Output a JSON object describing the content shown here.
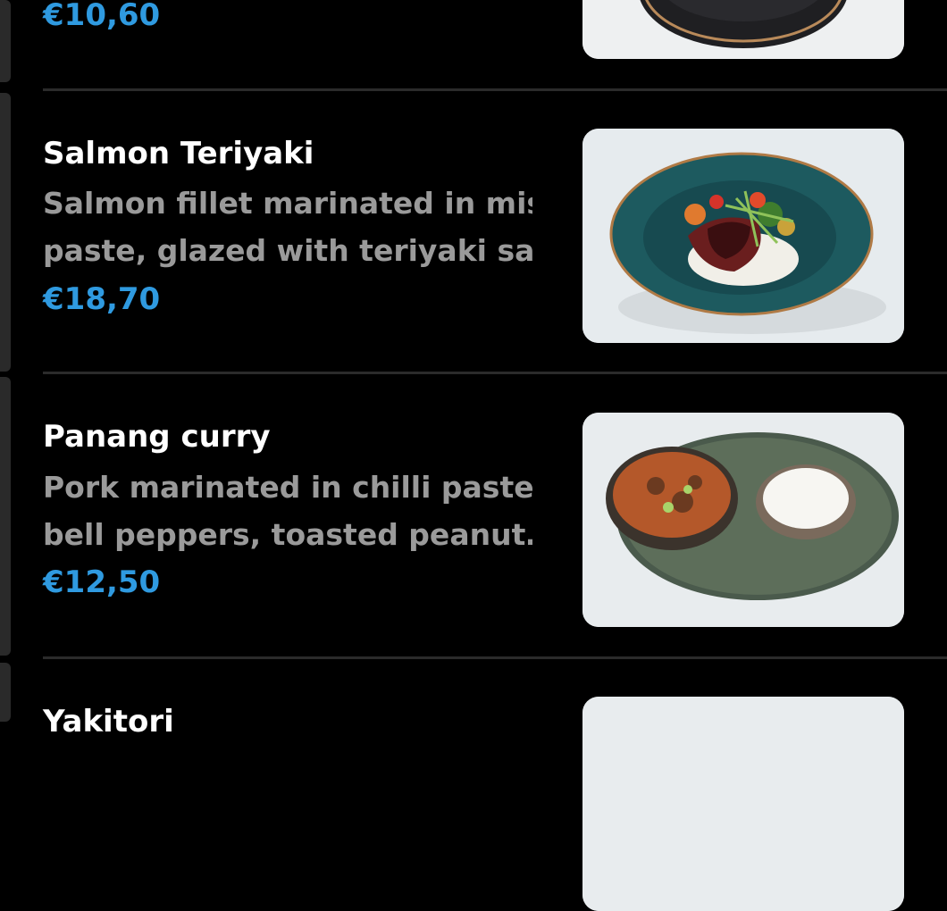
{
  "colors": {
    "background": "#000000",
    "price": "#2f9ae0",
    "description": "#9a9a9a",
    "title": "#ffffff",
    "divider": "#2b2b2b"
  },
  "menu": {
    "items": [
      {
        "price": "€10,60",
        "image_icon": "dish-photo"
      },
      {
        "name": "Salmon Teriyaki",
        "description_line1": "Salmon fillet marinated in miso",
        "description_line2": "paste, glazed with teriyaki sa…",
        "price": "€18,70",
        "image_icon": "salmon-teriyaki-photo"
      },
      {
        "name": "Panang curry",
        "description_line1": "Pork marinated in chilli paste,",
        "description_line2": "bell peppers, toasted peanut…",
        "price": "€12,50",
        "image_icon": "panang-curry-photo"
      },
      {
        "name": "Yakitori",
        "image_icon": "yakitori-photo"
      }
    ]
  }
}
